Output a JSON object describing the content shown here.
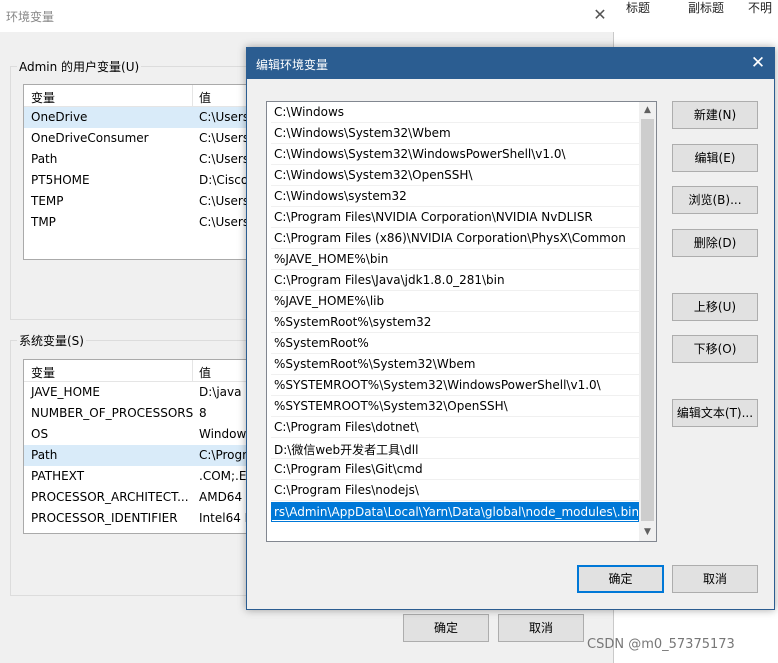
{
  "bg_app": {
    "tabs": [
      "标题",
      "副标题",
      "不明"
    ]
  },
  "back_window": {
    "title": "环境变量",
    "user_group_label": "Admin 的用户变量(U)",
    "user_columns": [
      "变量",
      "值"
    ],
    "user_vars": [
      {
        "name": "OneDrive",
        "value": "C:\\Users"
      },
      {
        "name": "OneDriveConsumer",
        "value": "C:\\Users"
      },
      {
        "name": "Path",
        "value": "C:\\Users"
      },
      {
        "name": "PT5HOME",
        "value": "D:\\Cisco"
      },
      {
        "name": "TEMP",
        "value": "C:\\Users"
      },
      {
        "name": "TMP",
        "value": "C:\\Users"
      }
    ],
    "system_group_label": "系统变量(S)",
    "system_columns": [
      "变量",
      "值"
    ],
    "system_vars": [
      {
        "name": "JAVE_HOME",
        "value": "D:\\java"
      },
      {
        "name": "NUMBER_OF_PROCESSORS",
        "value": "8"
      },
      {
        "name": "OS",
        "value": "Window"
      },
      {
        "name": "Path",
        "value": "C:\\Progr"
      },
      {
        "name": "PATHEXT",
        "value": ".COM;.E"
      },
      {
        "name": "PROCESSOR_ARCHITECT...",
        "value": "AMD64"
      },
      {
        "name": "PROCESSOR_IDENTIFIER",
        "value": "Intel64 F"
      }
    ],
    "ok_label": "确定",
    "cancel_label": "取消",
    "close_glyph": "✕"
  },
  "dialog": {
    "title": "编辑环境变量",
    "close_glyph": "✕",
    "paths": [
      "C:\\Windows",
      "C:\\Windows\\System32\\Wbem",
      "C:\\Windows\\System32\\WindowsPowerShell\\v1.0\\",
      "C:\\Windows\\System32\\OpenSSH\\",
      "C:\\Windows\\system32",
      "C:\\Program Files\\NVIDIA Corporation\\NVIDIA NvDLISR",
      "C:\\Program Files (x86)\\NVIDIA Corporation\\PhysX\\Common",
      "%JAVE_HOME%\\bin",
      "C:\\Program Files\\Java\\jdk1.8.0_281\\bin",
      "%JAVE_HOME%\\lib",
      "%SystemRoot%\\system32",
      "%SystemRoot%",
      "%SystemRoot%\\System32\\Wbem",
      "%SYSTEMROOT%\\System32\\WindowsPowerShell\\v1.0\\",
      "%SYSTEMROOT%\\System32\\OpenSSH\\",
      "C:\\Program Files\\dotnet\\",
      "D:\\微信web开发者工具\\dll",
      "C:\\Program Files\\Git\\cmd",
      "C:\\Program Files\\nodejs\\"
    ],
    "editing_value": "rs\\Admin\\AppData\\Local\\Yarn\\Data\\global\\node_modules\\.bin",
    "buttons": {
      "new": "新建(N)",
      "edit": "编辑(E)",
      "browse": "浏览(B)...",
      "delete": "删除(D)",
      "move_up": "上移(U)",
      "move_down": "下移(O)",
      "edit_text": "编辑文本(T)...",
      "ok": "确定",
      "cancel": "取消"
    },
    "scroll_up_glyph": "▲",
    "scroll_down_glyph": "▼"
  },
  "watermark": "CSDN @m0_57375173"
}
